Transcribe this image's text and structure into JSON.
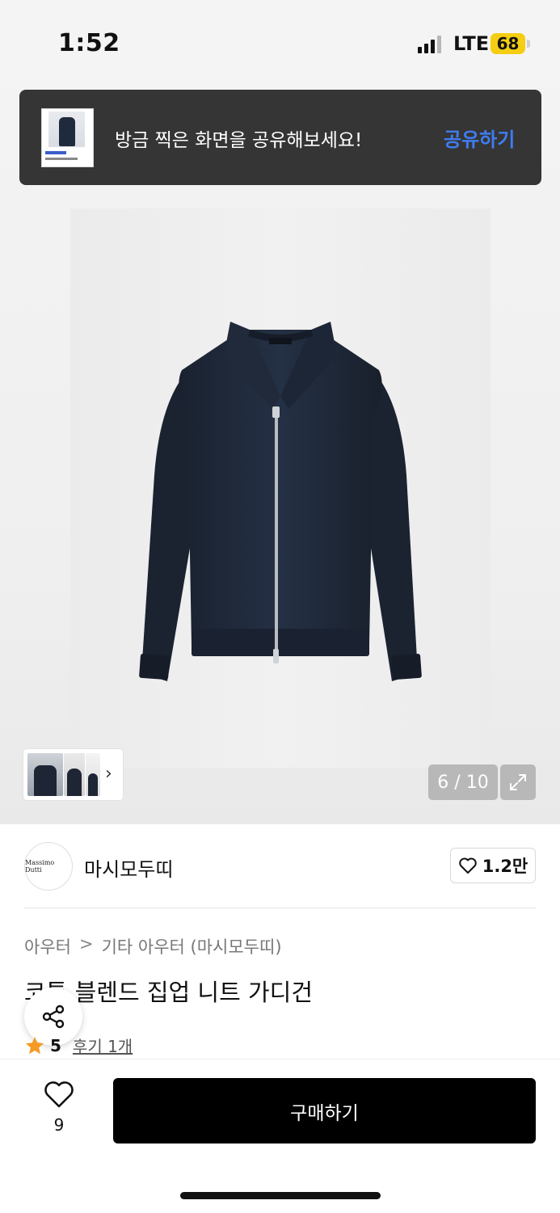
{
  "status_bar": {
    "time": "1:52",
    "network": "LTE",
    "battery": "68"
  },
  "share_banner": {
    "message": "방금 찍은 화면을 공유해보세요!",
    "action_label": "공유하기"
  },
  "gallery": {
    "counter": "6 / 10",
    "expand_icon": "expand-icon",
    "thumbnails_more_icon": "chevron-right-icon"
  },
  "brand": {
    "logo_text": "Massimo Dutti",
    "name": "마시모두띠",
    "like_count": "1.2만"
  },
  "breadcrumb": {
    "level1": "아우터",
    "separator": ">",
    "level2": "기타 아우터 (마시모두띠)"
  },
  "product": {
    "title": "코튼 블렌드 집업 니트 가디건",
    "rating": "5",
    "reviews_label": "후기 1개"
  },
  "bottom_bar": {
    "wish_count": "9",
    "buy_label": "구매하기"
  },
  "colors": {
    "accent": "#3f7cf0",
    "banner_bg": "#353535",
    "star": "#f59a23",
    "battery": "#f5cd12"
  }
}
